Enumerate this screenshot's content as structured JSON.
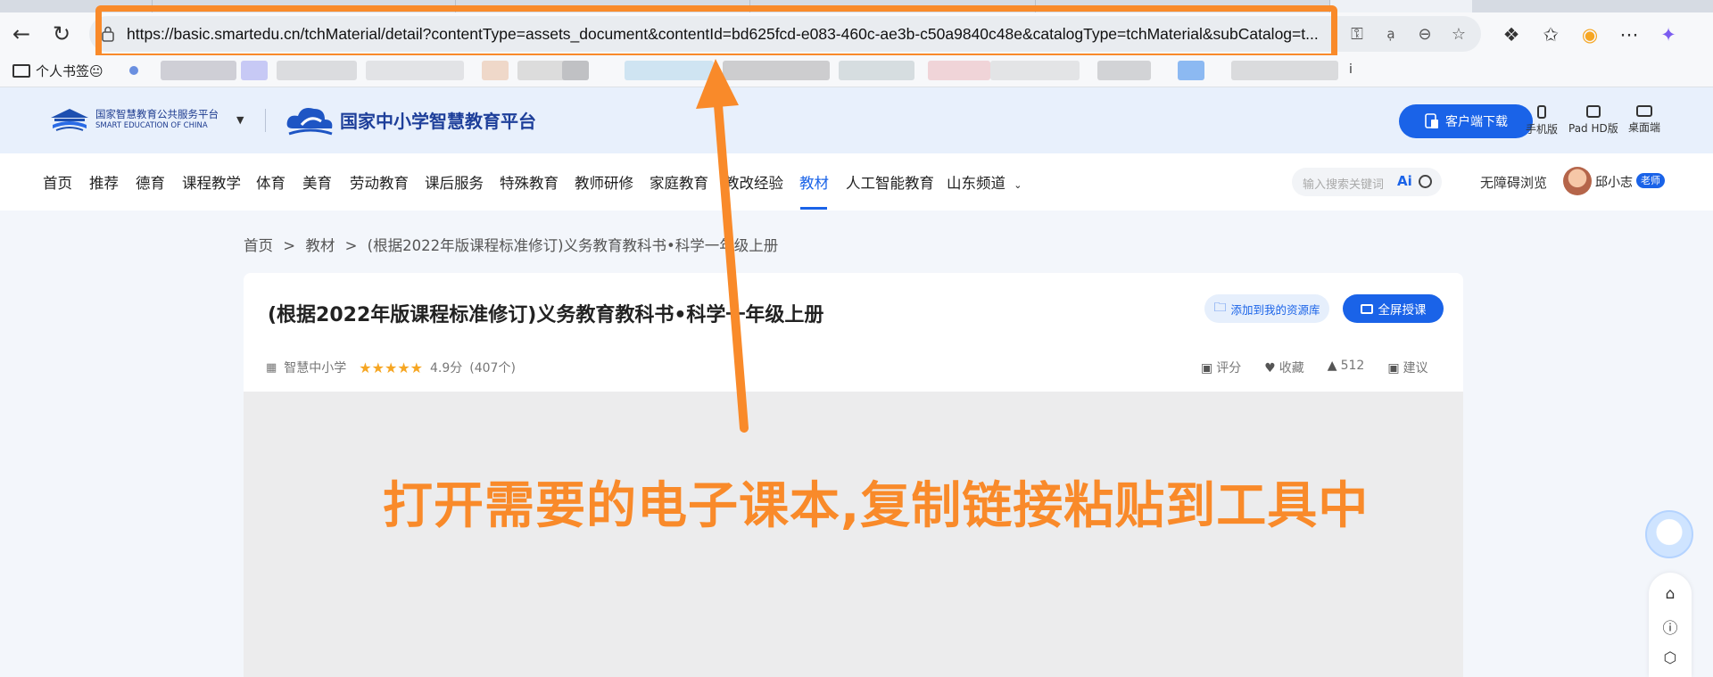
{
  "browser": {
    "url": "https://basic.smartedu.cn/tchMaterial/detail?contentType=assets_document&contentId=bd625fcd-e083-460c-ae3b-c50a9840c48e&catalogType=tchMaterial&subCatalog=t...",
    "bookmark_folder": "个人书签😐",
    "bookmark_char": "i"
  },
  "site": {
    "logo1_cn": "国家智慧教育公共服务平台",
    "logo1_en": "SMART EDUCATION OF CHINA",
    "logo2": "国家中小学智慧教育平台",
    "download_btn": "客户端下载",
    "devices": [
      "手机版",
      "Pad HD版",
      "桌面端"
    ]
  },
  "nav": {
    "items": [
      "首页",
      "推荐",
      "德育",
      "课程教学",
      "体育",
      "美育",
      "劳动教育",
      "课后服务",
      "特殊教育",
      "教师研修",
      "家庭教育",
      "教改经验",
      "教材",
      "人工智能教育",
      "山东频道"
    ],
    "active": "教材",
    "search_placeholder": "输入搜索关键词",
    "ai_label": "Ai",
    "accessibility": "无障碍浏览",
    "user_name": "邱小志",
    "user_role": "老师"
  },
  "breadcrumb": [
    "首页",
    ">",
    "教材",
    ">",
    "(根据2022年版课程标准修订)义务教育教科书•科学一年级上册"
  ],
  "material": {
    "title": "(根据2022年版课程标准修订)义务教育教科书•科学一年级上册",
    "add_to_library": "添加到我的资源库",
    "fullscreen": "全屏授课",
    "publisher": "智慧中小学",
    "rating": 4.9,
    "rating_text": "4.9分",
    "rating_count": "(407个)",
    "actions": {
      "comment": "评分",
      "favorite": "收藏",
      "likes": "512",
      "suggest": "建议"
    }
  },
  "annotation": {
    "text": "打开需要的电子课本,复制链接粘贴到工具中",
    "color": "#f98a2a"
  },
  "colors": {
    "brand": "#1a63e8",
    "annotation": "#f98a2a"
  }
}
